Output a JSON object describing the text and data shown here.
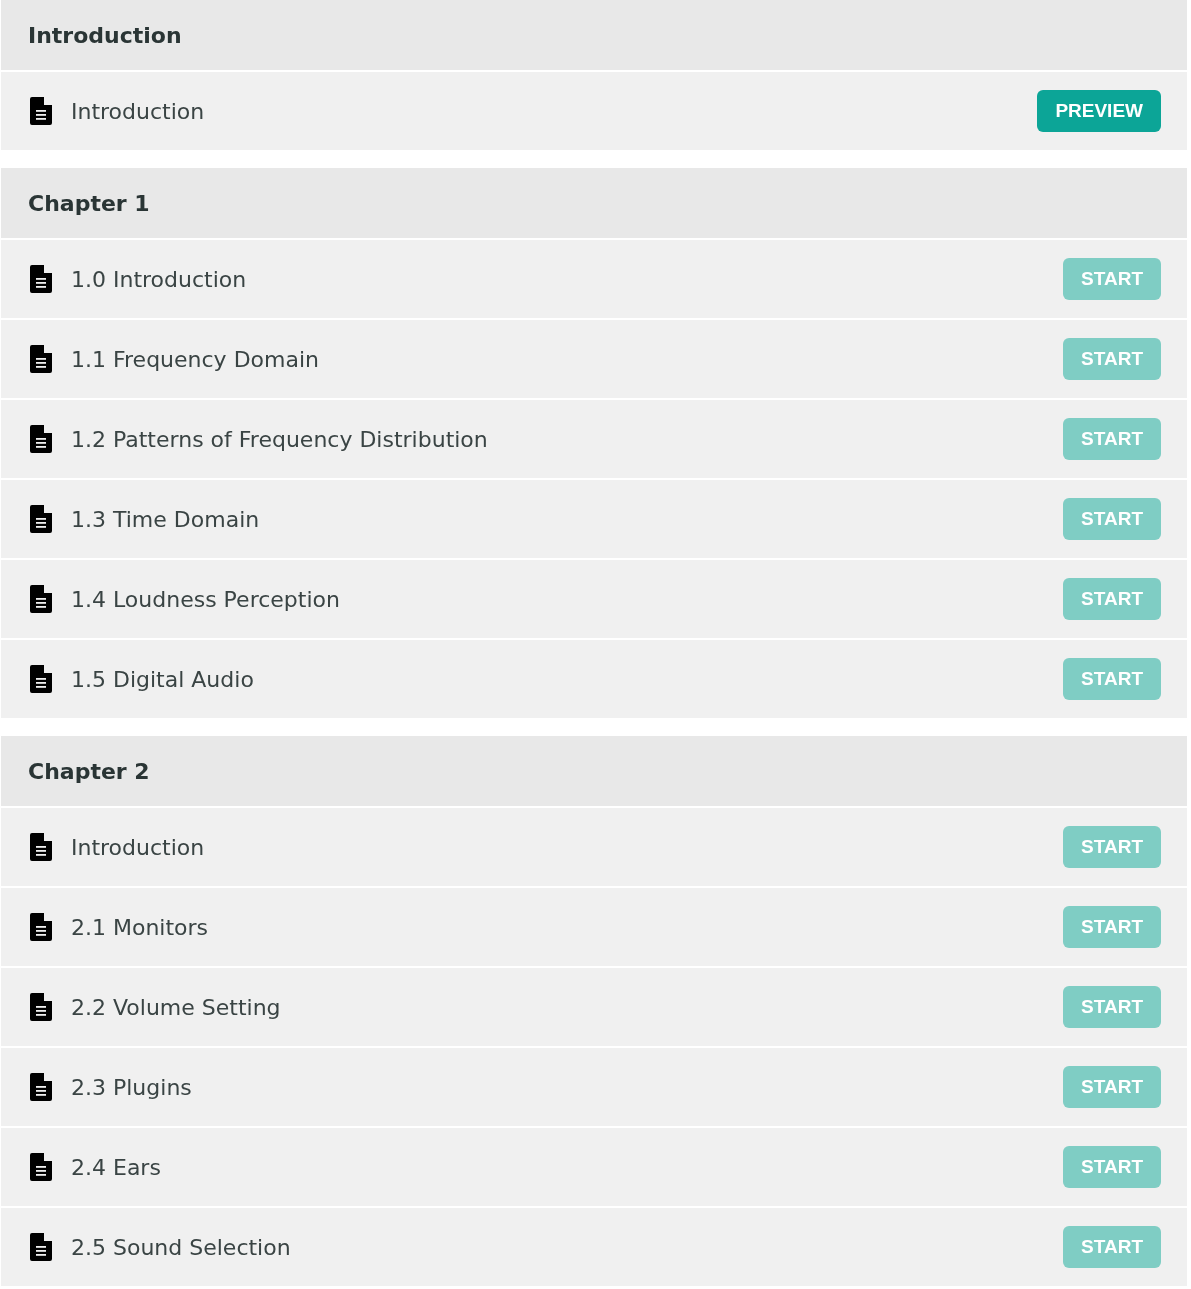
{
  "sections": [
    {
      "title": "Introduction",
      "lectures": [
        {
          "title": "Introduction",
          "action": {
            "label": "PREVIEW",
            "kind": "preview"
          }
        }
      ]
    },
    {
      "title": "Chapter 1",
      "lectures": [
        {
          "title": "1.0 Introduction",
          "action": {
            "label": "START",
            "kind": "start"
          }
        },
        {
          "title": "1.1 Frequency Domain",
          "action": {
            "label": "START",
            "kind": "start"
          }
        },
        {
          "title": "1.2 Patterns of Frequency Distribution",
          "action": {
            "label": "START",
            "kind": "start"
          }
        },
        {
          "title": "1.3 Time Domain",
          "action": {
            "label": "START",
            "kind": "start"
          }
        },
        {
          "title": "1.4 Loudness Perception",
          "action": {
            "label": "START",
            "kind": "start"
          }
        },
        {
          "title": "1.5 Digital Audio",
          "action": {
            "label": "START",
            "kind": "start"
          }
        }
      ]
    },
    {
      "title": "Chapter 2",
      "lectures": [
        {
          "title": "Introduction",
          "action": {
            "label": "START",
            "kind": "start"
          }
        },
        {
          "title": "2.1 Monitors",
          "action": {
            "label": "START",
            "kind": "start"
          }
        },
        {
          "title": "2.2 Volume Setting",
          "action": {
            "label": "START",
            "kind": "start"
          }
        },
        {
          "title": "2.3 Plugins",
          "action": {
            "label": "START",
            "kind": "start"
          }
        },
        {
          "title": "2.4 Ears",
          "action": {
            "label": "START",
            "kind": "start"
          }
        },
        {
          "title": "2.5 Sound Selection",
          "action": {
            "label": "START",
            "kind": "start"
          }
        }
      ]
    }
  ]
}
